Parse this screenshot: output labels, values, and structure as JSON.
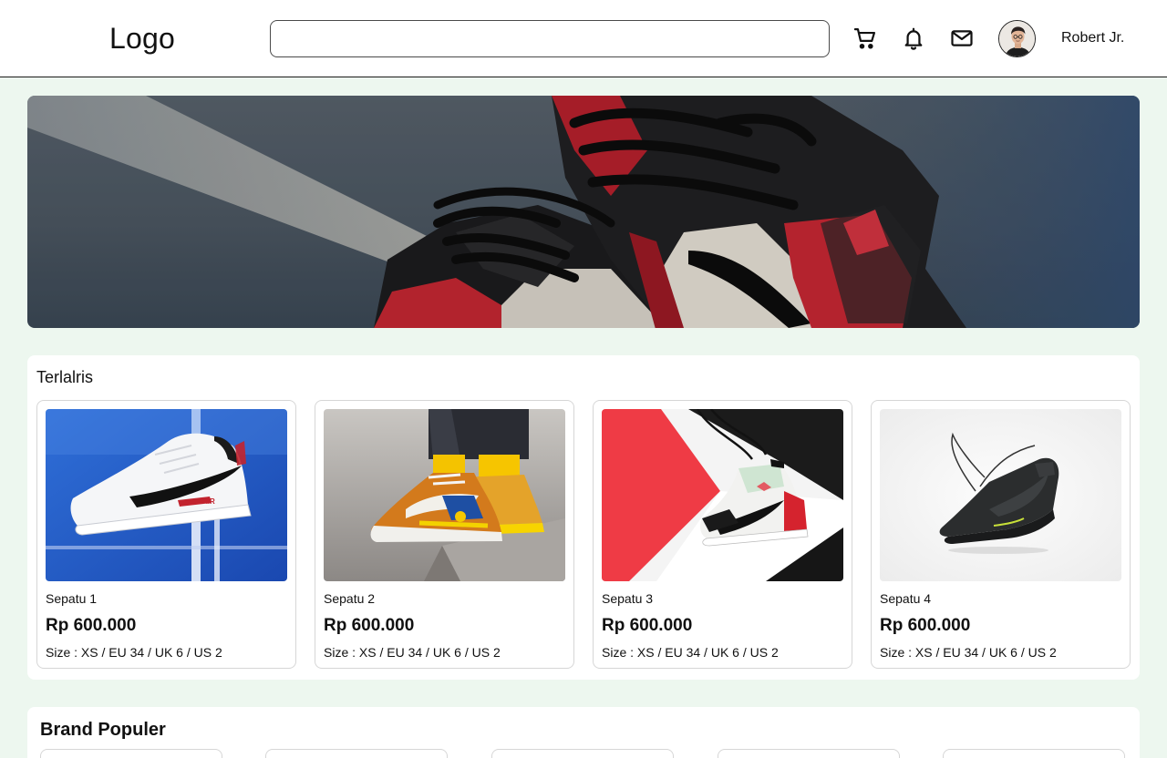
{
  "header": {
    "logo": "Logo",
    "search": {
      "value": "",
      "placeholder": ""
    },
    "icons": [
      "cart-icon",
      "bell-icon",
      "mail-icon"
    ],
    "user": {
      "name": "Robert Jr.",
      "avatar": "avatar-icon"
    }
  },
  "hero": {
    "image": "sneaker-banner"
  },
  "best_seller": {
    "title": "Terlalris",
    "products": [
      {
        "name": "Sepatu 1",
        "price": "Rp 600.000",
        "size": "Size : XS / EU 34 / UK 6 / US 2"
      },
      {
        "name": "Sepatu 2",
        "price": "Rp 600.000",
        "size": "Size : XS / EU 34 / UK 6 / US 2"
      },
      {
        "name": "Sepatu 3",
        "price": "Rp 600.000",
        "size": "Size : XS / EU 34 / UK 6 / US 2"
      },
      {
        "name": "Sepatu 4",
        "price": "Rp 600.000",
        "size": "Size : XS / EU 34 / UK 6 / US 2"
      }
    ]
  },
  "brands": {
    "title": "Brand Populer"
  },
  "colors": {
    "page_bg": "#edf7ef",
    "card_border": "#d6d6d6",
    "text": "#111111"
  }
}
